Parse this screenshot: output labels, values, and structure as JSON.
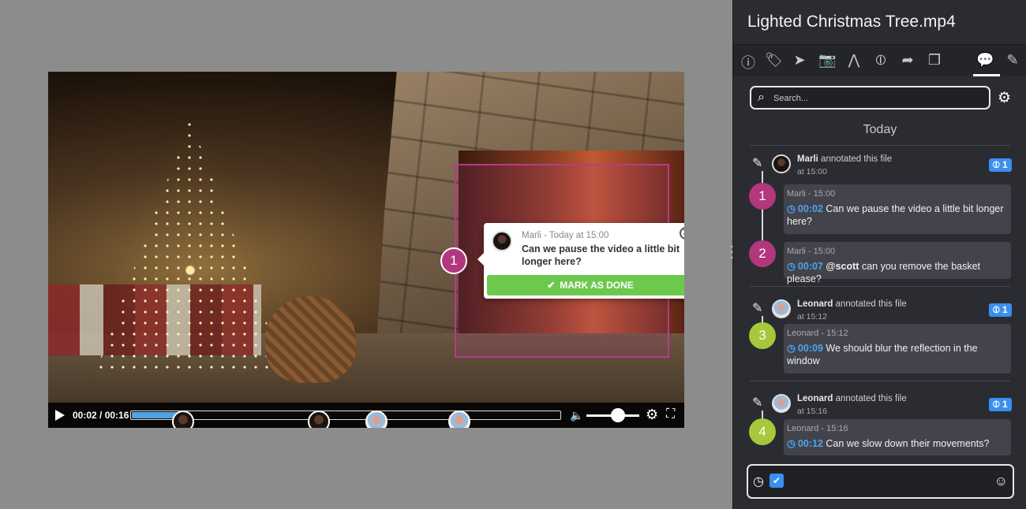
{
  "file": {
    "title": "Lighted Christmas Tree.mp4"
  },
  "toolbar": {
    "icons": [
      "info-icon",
      "tag-icon",
      "location-icon",
      "camera-icon",
      "waveform-icon",
      "commit-icon",
      "share-icon",
      "copy-icon",
      "comments-icon",
      "pencil-icon"
    ],
    "glyphs": [
      "ⓘ",
      "🏷",
      "➤",
      "📷",
      "⋀",
      "⦶",
      "➦",
      "❐",
      "💬",
      "✎"
    ]
  },
  "search": {
    "placeholder": "Search..."
  },
  "timeline": {
    "day_label": "Today"
  },
  "player": {
    "time": "00:02 / 00:16",
    "progress": 0.11,
    "volume": 0.6,
    "marker_number": "1"
  },
  "popup": {
    "meta": "Marli - Today at 15:00",
    "message": "Can we pause the video a little bit longer here?",
    "button": "MARK AS DONE"
  },
  "groups": [
    {
      "author": "Marli",
      "action": "annotated this file",
      "time": "at 15:00",
      "badge": "1",
      "comments": [
        {
          "number": "1",
          "color": "magenta",
          "meta": "Marli - 15:00",
          "timestamp": "00:02",
          "text": "Can we pause the video a little bit longer here?"
        },
        {
          "number": "2",
          "color": "magenta",
          "meta": "Marli - 15:00",
          "timestamp": "00:07",
          "mention": "@scott",
          "text": "can you remove the basket please?"
        }
      ]
    },
    {
      "author": "Leonard",
      "action": "annotated this file",
      "time": "at 15:12",
      "badge": "1",
      "comments": [
        {
          "number": "3",
          "color": "green",
          "meta": "Leonard - 15:12",
          "timestamp": "00:09",
          "text": "We should blur the reflection in the window"
        }
      ]
    },
    {
      "author": "Leonard",
      "action": "annotated this file",
      "time": "at 15:16",
      "badge": "1",
      "comments": [
        {
          "number": "4",
          "color": "green",
          "meta": "Leonard - 15:16",
          "timestamp": "00:12",
          "text": "Can we slow down their movements?"
        }
      ]
    }
  ],
  "colors": {
    "accent": "#3a8ff0",
    "magenta": "#b2377c",
    "green": "#a6c83a",
    "done": "#6cc94e"
  }
}
